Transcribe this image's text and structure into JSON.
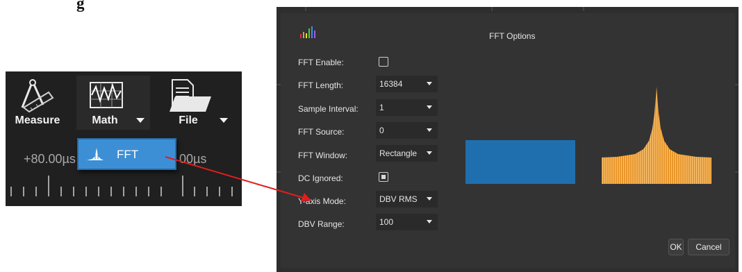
{
  "document": {
    "heading_fragment": "g"
  },
  "toolbar": {
    "measure_label": "Measure",
    "math_label": "Math",
    "file_label": "File",
    "time_left": "+80.00µs",
    "time_right": "00µs",
    "popup_label": "FFT"
  },
  "dialog": {
    "title": "FFT Options",
    "rows": [
      {
        "label": "FFT Enable:",
        "control": "checkbox",
        "checked": false
      },
      {
        "label": "FFT Length:",
        "control": "select",
        "value": "16384"
      },
      {
        "label": "Sample Interval:",
        "control": "select",
        "value": "1"
      },
      {
        "label": "FFT Source:",
        "control": "select",
        "value": "0"
      },
      {
        "label": "FFT Window:",
        "control": "select",
        "value": "Rectangle"
      },
      {
        "label": "DC Ignored:",
        "control": "checkbox",
        "checked": true
      },
      {
        "label": "Y-axis Mode:",
        "control": "select",
        "value": "DBV RMS"
      },
      {
        "label": "DBV Range:",
        "control": "select",
        "value": "100"
      }
    ],
    "ok_label": "OK",
    "cancel_label": "Cancel",
    "window_preview_color": "#1f6fae",
    "spectrum_preview_color": "#e8962a",
    "accent_color": "#3c8fd5",
    "arrow_color": "#e11d1d"
  }
}
